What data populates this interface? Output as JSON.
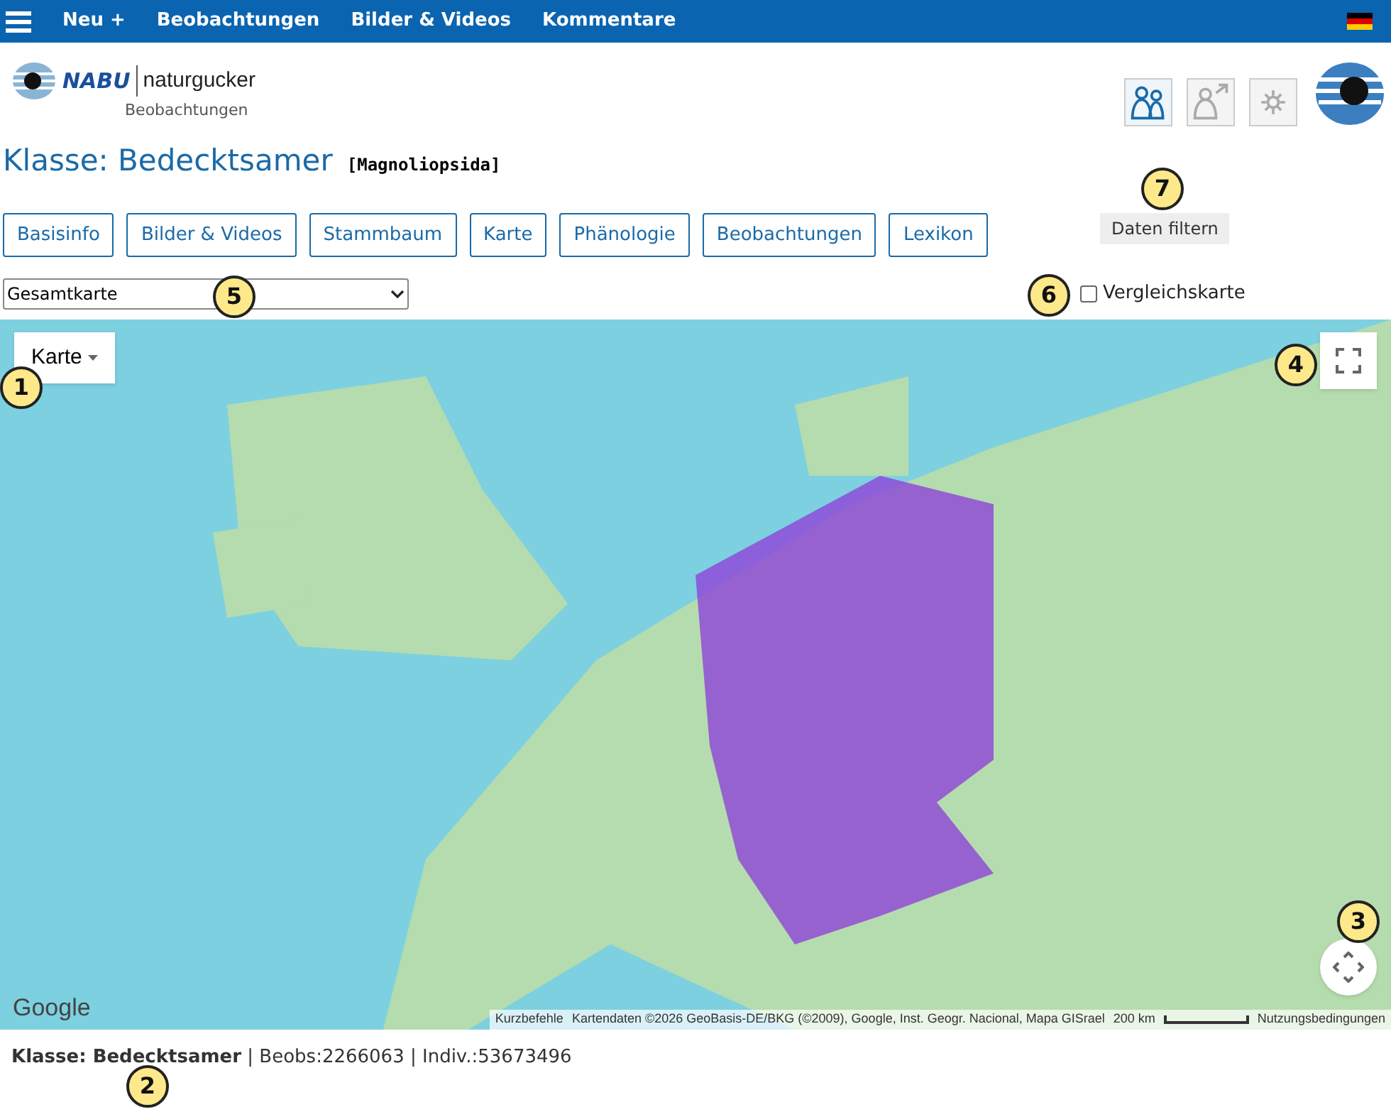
{
  "top_nav": {
    "items": [
      "Neu +",
      "Beobachtungen",
      "Bilder & Videos",
      "Kommentare"
    ]
  },
  "logo": {
    "brand": "NABU",
    "name": "naturgucker",
    "subtitle": "Beobachtungen"
  },
  "header_buttons": [
    {
      "kind": "people",
      "disabled": false
    },
    {
      "kind": "person-arrow",
      "disabled": true
    },
    {
      "kind": "sun",
      "disabled": true
    }
  ],
  "title": {
    "text": "Klasse: Bedecktsamer",
    "latin": "[Magnoliopsida]"
  },
  "filter_button": "Daten filtern",
  "tabs": [
    "Basisinfo",
    "Bilder & Videos",
    "Stammbaum",
    "Karte",
    "Phänologie",
    "Beobachtungen",
    "Lexikon"
  ],
  "map_select": {
    "value": "Gesamtkarte"
  },
  "compare_checkbox": {
    "label": "Vergleichskarte",
    "checked": false
  },
  "map": {
    "type_button": "Karte",
    "google": "Google",
    "attribution": [
      "Kurzbefehle",
      "Kartendaten ©2026 GeoBasis-DE/BKG (©2009), Google, Inst. Geogr. Nacional, Mapa GISrael"
    ],
    "scale": "200 km",
    "terms": "Nutzungsbedingungen"
  },
  "summary": "**Klasse: Bedecktsamer** | Beobs:2266063 | Indiv.:53673496",
  "markers": [
    "1",
    "2",
    "3",
    "4",
    "5",
    "6",
    "7"
  ]
}
